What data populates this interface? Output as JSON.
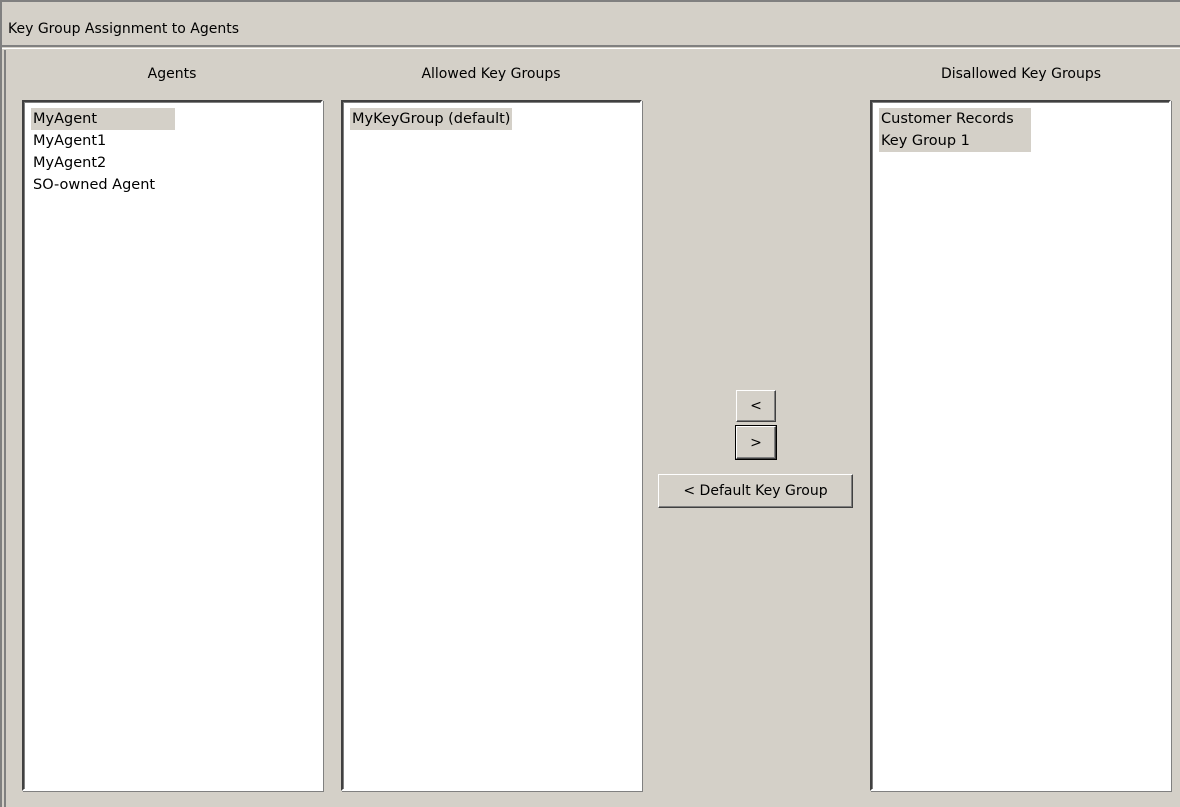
{
  "window": {
    "title": "Key Group Assignment to Agents"
  },
  "agents": {
    "header": "Agents",
    "items": [
      "MyAgent",
      "MyAgent1",
      "MyAgent2",
      "SO-owned Agent"
    ],
    "selected_index": 0
  },
  "allowed": {
    "header": "Allowed Key Groups",
    "items": [
      "MyKeyGroup (default)"
    ],
    "selected_index": 0
  },
  "disallowed": {
    "header": "Disallowed Key Groups",
    "items": [
      "Customer Records",
      "Key Group 1"
    ],
    "selected_indices": [
      0,
      1
    ]
  },
  "buttons": {
    "move_left": "<",
    "move_right": ">",
    "set_default": "< Default Key Group"
  }
}
